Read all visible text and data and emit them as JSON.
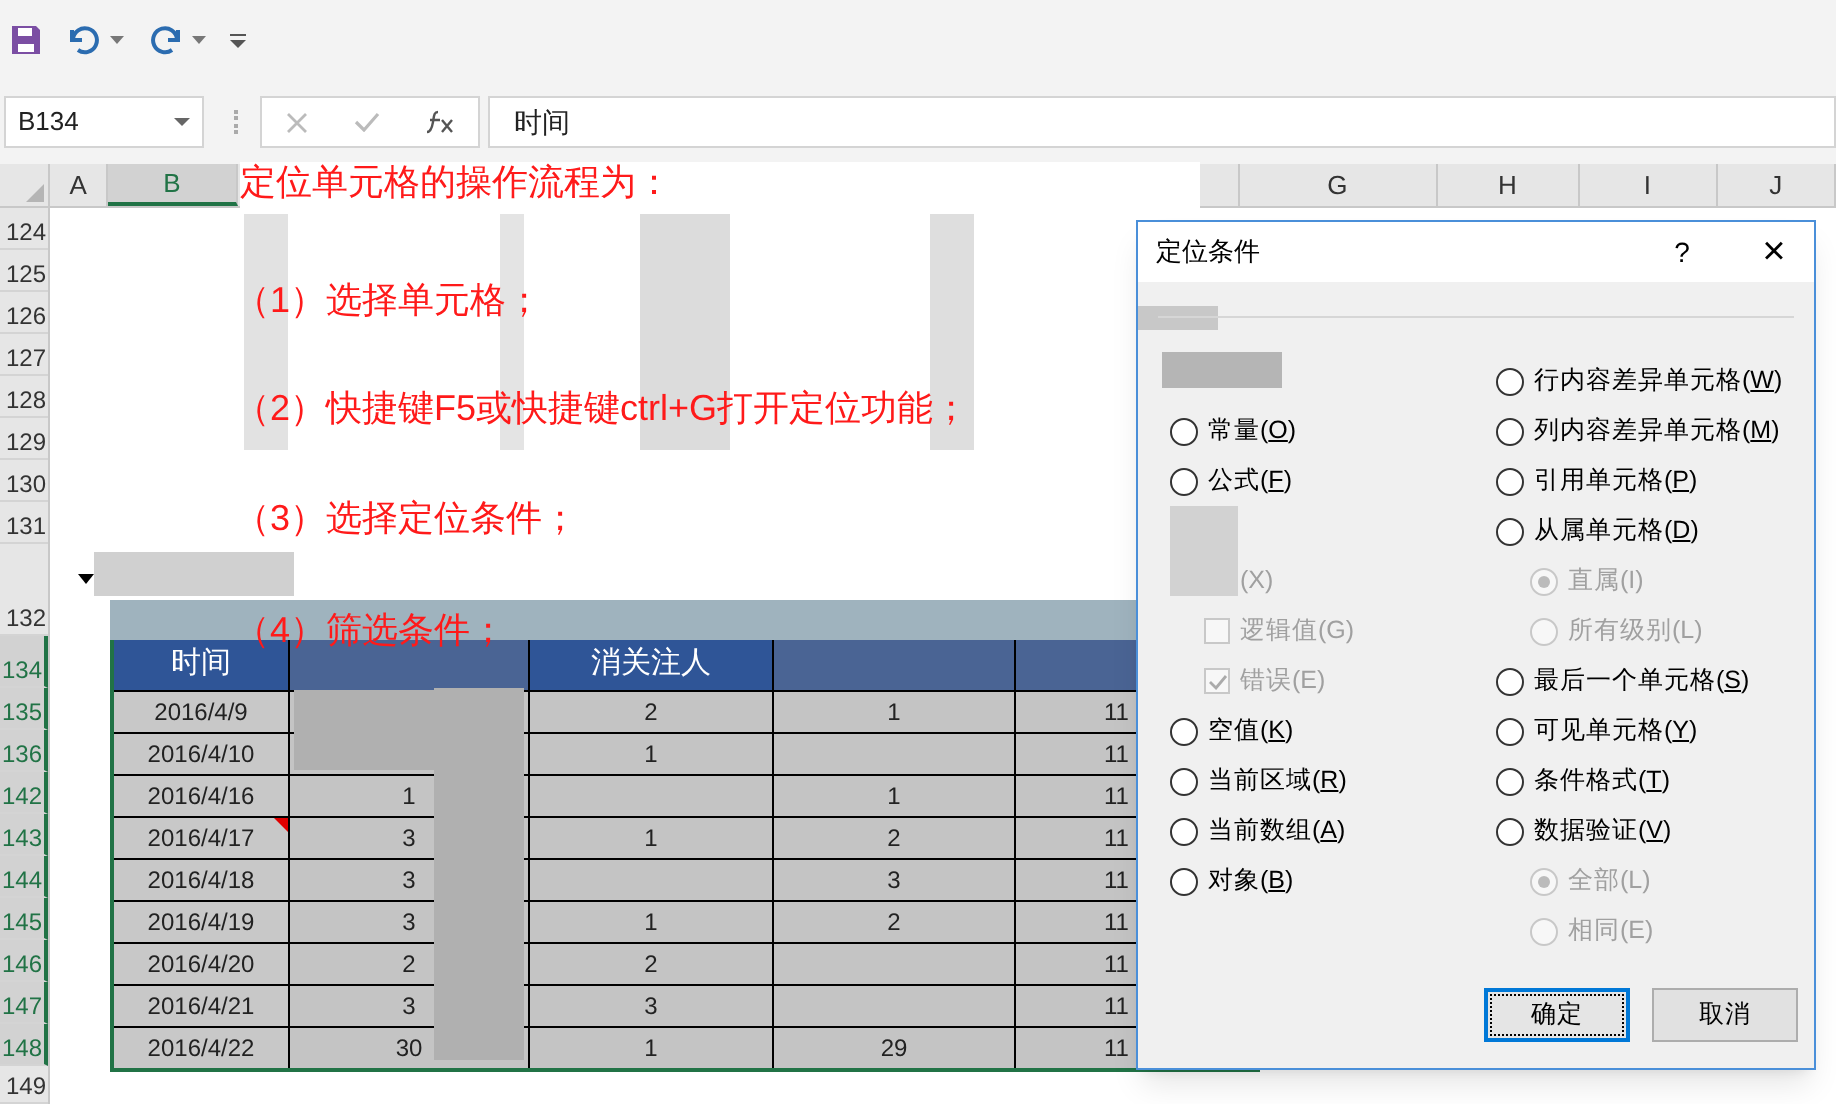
{
  "name_box": {
    "value": "B134"
  },
  "formula_bar": {
    "value": "时间"
  },
  "columns": [
    {
      "label": "A",
      "selected": false
    },
    {
      "label": "B",
      "selected": true
    },
    {
      "label": "G",
      "selected": false
    },
    {
      "label": "H",
      "selected": false
    },
    {
      "label": "I",
      "selected": false
    },
    {
      "label": "J",
      "selected": false
    }
  ],
  "rows": [
    {
      "label": "124",
      "selected": false
    },
    {
      "label": "125",
      "selected": false
    },
    {
      "label": "126",
      "selected": false
    },
    {
      "label": "127",
      "selected": false
    },
    {
      "label": "128",
      "selected": false
    },
    {
      "label": "129",
      "selected": false
    },
    {
      "label": "130",
      "selected": false
    },
    {
      "label": "131",
      "selected": false
    },
    {
      "label": "132",
      "selected": false
    },
    {
      "label": "134",
      "selected": true
    },
    {
      "label": "135",
      "selected": true
    },
    {
      "label": "136",
      "selected": true
    },
    {
      "label": "142",
      "selected": true
    },
    {
      "label": "143",
      "selected": true
    },
    {
      "label": "144",
      "selected": true
    },
    {
      "label": "145",
      "selected": true
    },
    {
      "label": "146",
      "selected": true
    },
    {
      "label": "147",
      "selected": true
    },
    {
      "label": "148",
      "selected": true
    },
    {
      "label": "149",
      "selected": false
    }
  ],
  "instructions": {
    "title": "定位单元格的操作流程为：",
    "steps": [
      "（1）选择单元格；",
      "（2）快捷键F5或快捷键ctrl+G打开定位功能；",
      "（3）选择定位条件；",
      "（4）筛选条件；"
    ]
  },
  "table": {
    "headers": [
      {
        "kind": "text",
        "label": "时间"
      },
      {
        "kind": "blurred"
      },
      {
        "kind": "text",
        "label": "消关注人"
      },
      {
        "kind": "blurred"
      },
      {
        "kind": "blurred"
      }
    ],
    "rows": [
      {
        "cells": [
          "2016/4/9",
          null,
          "2",
          "1",
          "11"
        ],
        "comment": false
      },
      {
        "cells": [
          "2016/4/10",
          null,
          "1",
          null,
          "11"
        ],
        "comment": false
      },
      {
        "cells": [
          "2016/4/16",
          "1",
          null,
          "1",
          "11"
        ],
        "comment": false
      },
      {
        "cells": [
          "2016/4/17",
          "3",
          "1",
          "2",
          "11"
        ],
        "comment": true
      },
      {
        "cells": [
          "2016/4/18",
          "3",
          null,
          "3",
          "11"
        ],
        "comment": false
      },
      {
        "cells": [
          "2016/4/19",
          "3",
          "1",
          "2",
          "11"
        ],
        "comment": false
      },
      {
        "cells": [
          "2016/4/20",
          "2",
          "2",
          null,
          "11"
        ],
        "comment": false
      },
      {
        "cells": [
          "2016/4/21",
          "3",
          "3",
          null,
          "11"
        ],
        "comment": false
      },
      {
        "cells": [
          "2016/4/22",
          "30",
          "1",
          "29",
          "11"
        ],
        "comment": false
      }
    ]
  },
  "dialog": {
    "title": "定位条件",
    "help": "?",
    "close": "×",
    "left": [
      {
        "kind": "radio",
        "label": "常量(O)",
        "selected": false,
        "disabled": false
      },
      {
        "kind": "radio",
        "label": "公式(F)",
        "selected": false,
        "disabled": false,
        "children": [
          {
            "kind": "checkbox",
            "label": "(X)",
            "disabled": true,
            "obscured": true
          },
          {
            "kind": "checkbox",
            "label": "逻辑值(G)",
            "checked": false,
            "disabled": true,
            "obscured": false
          },
          {
            "kind": "checkbox",
            "label": "错误(E)",
            "checked": true,
            "disabled": true,
            "obscured": false
          }
        ]
      },
      {
        "kind": "radio",
        "label": "空值(K)",
        "selected": false,
        "disabled": false
      },
      {
        "kind": "radio",
        "label": "当前区域(R)",
        "selected": false,
        "disabled": false
      },
      {
        "kind": "radio",
        "label": "当前数组(A)",
        "selected": false,
        "disabled": false
      },
      {
        "kind": "radio",
        "label": "对象(B)",
        "selected": false,
        "disabled": false
      }
    ],
    "right": [
      {
        "kind": "radio",
        "label": "行内容差异单元格(W)",
        "selected": false,
        "disabled": false
      },
      {
        "kind": "radio",
        "label": "列内容差异单元格(M)",
        "selected": false,
        "disabled": false
      },
      {
        "kind": "radio",
        "label": "引用单元格(P)",
        "selected": false,
        "disabled": false
      },
      {
        "kind": "radio",
        "label": "从属单元格(D)",
        "selected": false,
        "disabled": false,
        "children": [
          {
            "kind": "radio",
            "label": "直属(I)",
            "selected": true,
            "disabled": true
          },
          {
            "kind": "radio",
            "label": "所有级别(L)",
            "selected": false,
            "disabled": true
          }
        ]
      },
      {
        "kind": "radio",
        "label": "最后一个单元格(S)",
        "selected": false,
        "disabled": false
      },
      {
        "kind": "radio",
        "label": "可见单元格(Y)",
        "selected": false,
        "disabled": false
      },
      {
        "kind": "radio",
        "label": "条件格式(T)",
        "selected": false,
        "disabled": false
      },
      {
        "kind": "radio",
        "label": "数据验证(V)",
        "selected": false,
        "disabled": false,
        "children": [
          {
            "kind": "radio",
            "label": "全部(L)",
            "selected": true,
            "disabled": true
          },
          {
            "kind": "radio",
            "label": "相同(E)",
            "selected": false,
            "disabled": true
          }
        ]
      }
    ],
    "buttons": [
      {
        "label": "确定",
        "focused": true
      },
      {
        "label": "取消",
        "focused": false
      }
    ]
  }
}
